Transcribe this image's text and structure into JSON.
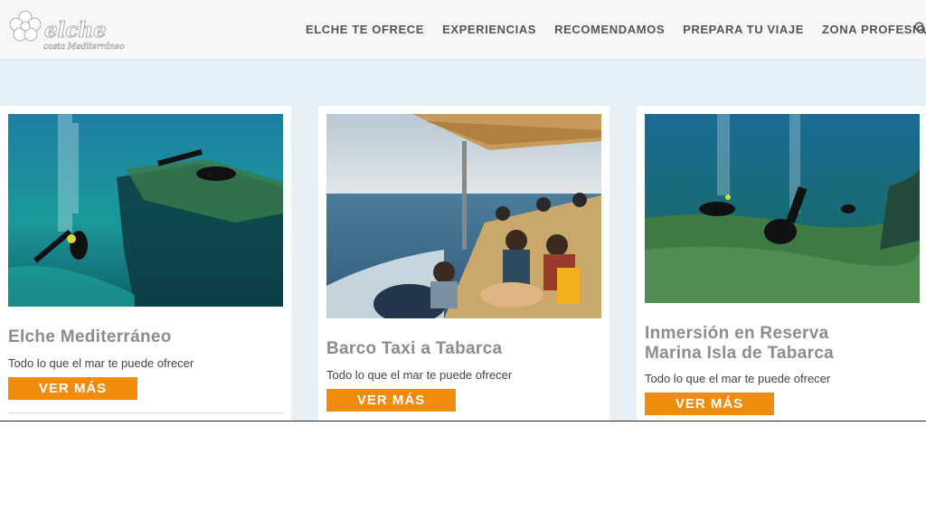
{
  "header": {
    "logo_text": "elche",
    "logo_tagline": "costa Mediterráneo",
    "nav": [
      {
        "label": "ELCHE TE OFRECE"
      },
      {
        "label": "EXPERIENCIAS"
      },
      {
        "label": "RECOMENDAMOS"
      },
      {
        "label": "PREPARA TU VIAJE"
      },
      {
        "label": "ZONA PROFESIONAL"
      }
    ],
    "search_icon": "search-icon"
  },
  "cards": [
    {
      "title": "Elche Mediterráneo",
      "description": "Todo lo que el mar te puede ofrecer",
      "button": "VER MÁS",
      "image": "underwater-divers-photo"
    },
    {
      "title": "Barco Taxi a Tabarca",
      "description": "Todo lo que el mar te puede ofrecer",
      "button": "VER MÁS",
      "image": "boat-passengers-photo"
    },
    {
      "title": "Inmersión en Reserva Marina Isla de Tabarca",
      "description": "Todo lo que el mar te puede ofrecer",
      "button": "VER MÁS",
      "image": "seagrass-divers-photo"
    }
  ],
  "colors": {
    "accent": "#f08c0c",
    "band": "#e6f0f8",
    "title": "#8c8c8c"
  }
}
